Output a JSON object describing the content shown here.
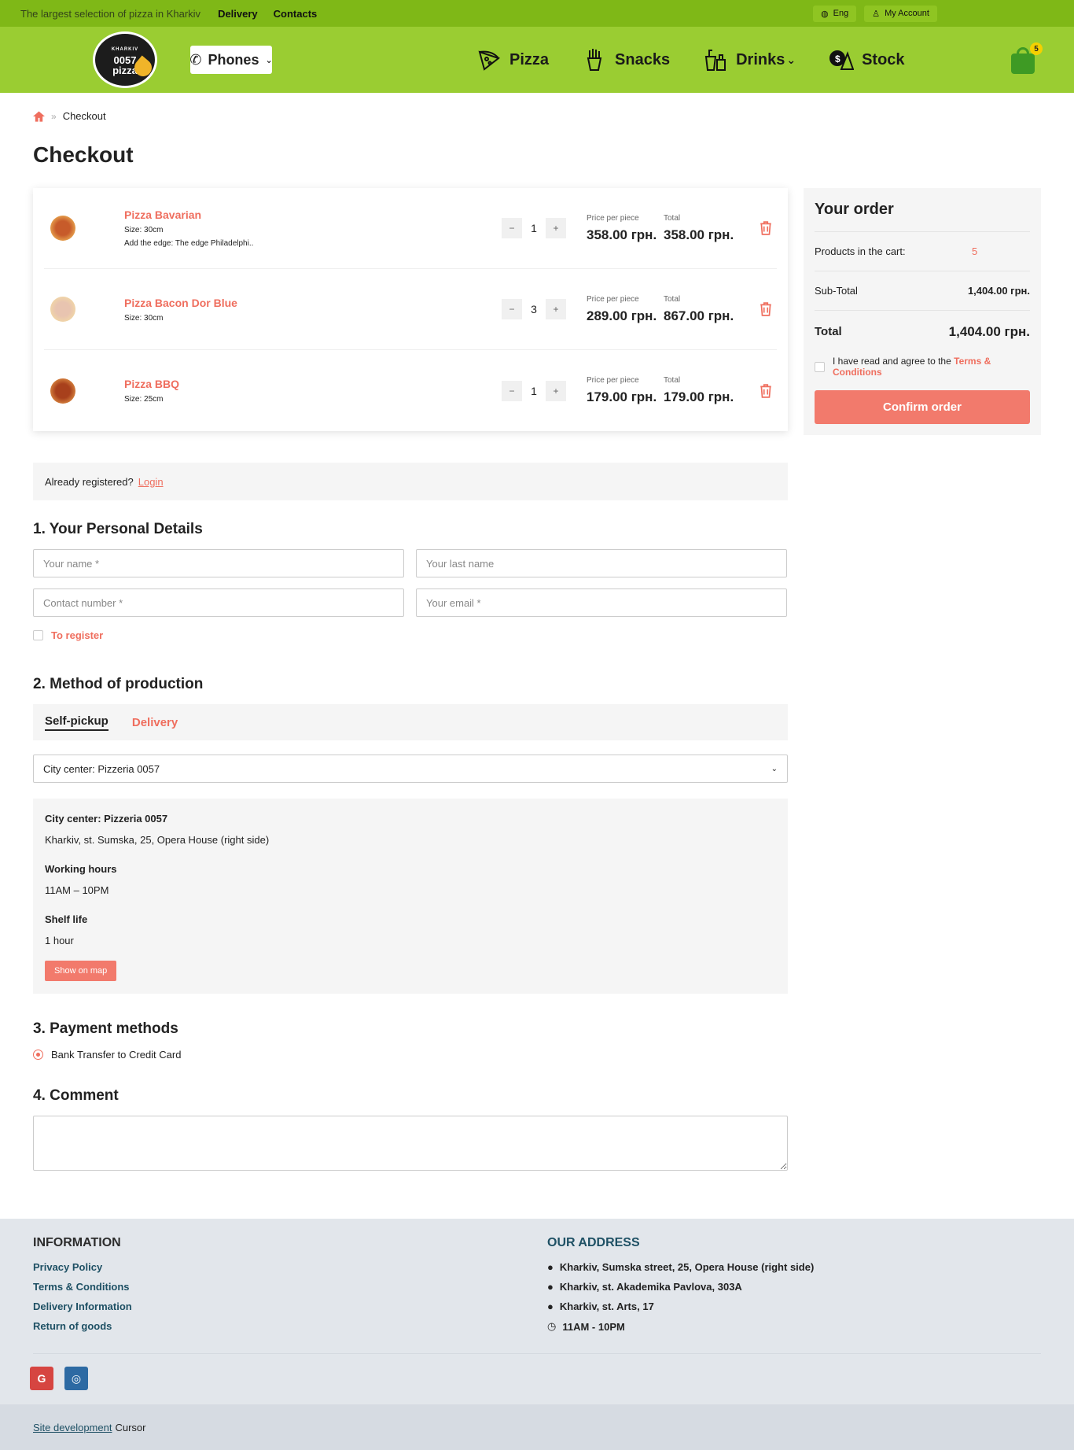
{
  "topbar": {
    "tagline": "The largest selection of pizza in Kharkiv",
    "links": [
      "Delivery",
      "Contacts"
    ],
    "lang": "Eng",
    "account": "My Account"
  },
  "header": {
    "logo_small": "KHARKIV",
    "logo_line1": "0057",
    "logo_line2": "pizza",
    "phones_label": "Phones",
    "nav": [
      "Pizza",
      "Snacks",
      "Drinks",
      "Stock"
    ],
    "cart_count": "5"
  },
  "breadcrumb": {
    "current": "Checkout"
  },
  "page_title": "Checkout",
  "cart": {
    "price_label": "Price per piece",
    "total_label": "Total",
    "items": [
      {
        "name": "Pizza Bavarian",
        "size": "Size: 30cm",
        "extra": "Add the edge: The edge Philadelphi..",
        "qty": "1",
        "price": "358.00 грн.",
        "total": "358.00 грн."
      },
      {
        "name": "Pizza Bacon Dor Blue",
        "size": "Size: 30cm",
        "extra": "",
        "qty": "3",
        "price": "289.00 грн.",
        "total": "867.00 грн."
      },
      {
        "name": "Pizza BBQ",
        "size": "Size: 25cm",
        "extra": "",
        "qty": "1",
        "price": "179.00 грн.",
        "total": "179.00 грн."
      }
    ]
  },
  "summary": {
    "title": "Your order",
    "products_label": "Products in the cart:",
    "products_value": "5",
    "subtotal_label": "Sub-Total",
    "subtotal_value": "1,404.00 грн.",
    "total_label": "Total",
    "total_value": "1,404.00 грн.",
    "agree_text": "I have read and agree to the",
    "agree_link": "Terms & Conditions",
    "confirm": "Confirm order"
  },
  "login": {
    "text": "Already registered?",
    "link": "Login"
  },
  "personal": {
    "title": "1. Your Personal Details",
    "name_ph": "Your name *",
    "last_ph": "Your last name",
    "phone_ph": "Contact number *",
    "email_ph": "Your email *",
    "register": "To register"
  },
  "method": {
    "title": "2. Method of production",
    "tab1": "Self-pickup",
    "tab2": "Delivery",
    "selected": "City center: Pizzeria 0057",
    "store": {
      "name": "City center: Pizzeria 0057",
      "address": "Kharkiv, st. Sumska, 25, Opera House (right side)",
      "hours_title": "Working hours",
      "hours": "11AM – 10PM",
      "shelf_title": "Shelf life",
      "shelf": "1 hour",
      "map_btn": "Show on map"
    }
  },
  "payment": {
    "title": "3. Payment methods",
    "option": "Bank Transfer to Credit Card"
  },
  "comment": {
    "title": "4. Comment"
  },
  "footer": {
    "info_title": "INFORMATION",
    "links": [
      "Privacy Policy",
      "Terms & Conditions",
      "Delivery Information",
      "Return of goods"
    ],
    "address_title": "OUR ADDRESS",
    "addresses": [
      "Kharkiv, Sumska street, 25, Opera House (right side)",
      "Kharkiv, st. Akademika Pavlova, 303A",
      "Kharkiv, st. Arts, 17"
    ],
    "hours": "11AM - 10PM",
    "social": [
      "G",
      "◎"
    ],
    "dev_link": "Site development",
    "dev_name": "Cursor"
  },
  "colors": {
    "accent": "#ef6e5e",
    "header": "#9acd32",
    "topbar": "#7fb817"
  }
}
